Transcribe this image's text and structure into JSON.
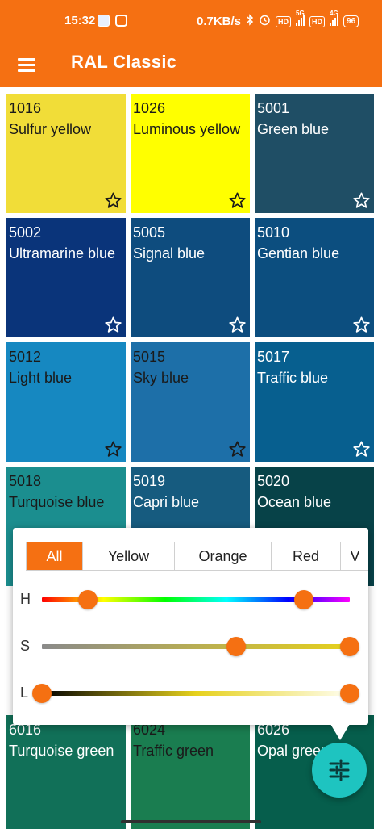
{
  "status_bar": {
    "time": "15:32",
    "net_speed": "0.7KB/s",
    "hd1": "HD",
    "sig1": "5G",
    "hd2": "HD",
    "sig2": "4G",
    "battery": "96"
  },
  "app_bar": {
    "title": "RAL Classic",
    "menu_icon": "hamburger-menu-icon"
  },
  "grid": {
    "tiles": [
      {
        "code": "1016",
        "name": "Sulfur yellow",
        "color": "#f1dd38",
        "text_color": "#1a1a1a"
      },
      {
        "code": "1026",
        "name": "Luminous yellow",
        "color": "#ffff00",
        "text_color": "#1a1a1a"
      },
      {
        "code": "5001",
        "name": "Green blue",
        "color": "#1f4e65",
        "text_color": "#ffffff"
      },
      {
        "code": "5002",
        "name": "Ultramarine blue",
        "color": "#0a347a",
        "text_color": "#ffffff"
      },
      {
        "code": "5005",
        "name": "Signal blue",
        "color": "#0e4c7e",
        "text_color": "#ffffff"
      },
      {
        "code": "5010",
        "name": "Gentian blue",
        "color": "#0c4e7f",
        "text_color": "#ffffff"
      },
      {
        "code": "5012",
        "name": "Light blue",
        "color": "#1688c1",
        "text_color": "#1a1a1a"
      },
      {
        "code": "5015",
        "name": "Sky blue",
        "color": "#1d6fa8",
        "text_color": "#1a1a1a"
      },
      {
        "code": "5017",
        "name": "Traffic blue",
        "color": "#075f8f",
        "text_color": "#ffffff"
      },
      {
        "code": "5018",
        "name": "Turquoise blue",
        "color": "#1b8e8f",
        "text_color": "#1a1a1a"
      },
      {
        "code": "5019",
        "name": "Capri blue",
        "color": "#165b7f",
        "text_color": "#ffffff"
      },
      {
        "code": "5020",
        "name": "Ocean blue",
        "color": "#074248",
        "text_color": "#ffffff"
      },
      {
        "code": "6016",
        "name": "Turquoise green",
        "color": "#117058",
        "text_color": "#ffffff"
      },
      {
        "code": "6024",
        "name": "Traffic green",
        "color": "#1a7d50",
        "text_color": "#1a1a1a"
      },
      {
        "code": "6026",
        "name": "Opal green",
        "color": "#065e4c",
        "text_color": "#ffffff"
      }
    ],
    "star_icon": "star-outline-icon"
  },
  "filter_panel": {
    "tabs": [
      {
        "label": "All",
        "active": true
      },
      {
        "label": "Yellow",
        "active": false
      },
      {
        "label": "Orange",
        "active": false
      },
      {
        "label": "Red",
        "active": false
      },
      {
        "label": "V",
        "active": false
      }
    ],
    "sliders": [
      {
        "label": "H",
        "low": 0.15,
        "high": 0.85
      },
      {
        "label": "S",
        "low": 0.63,
        "high": 1.0
      },
      {
        "label": "L",
        "low": 0.0,
        "high": 1.0
      }
    ]
  },
  "fab": {
    "icon": "tune-sliders-icon",
    "color": "#1ec4c0"
  },
  "colors": {
    "accent": "#f57012"
  }
}
